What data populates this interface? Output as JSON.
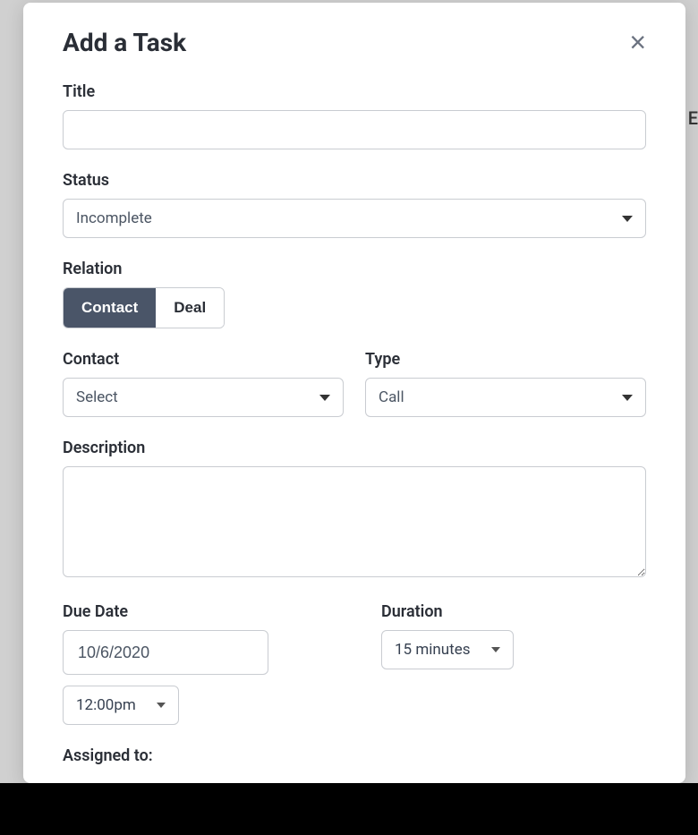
{
  "background": {
    "letter": "E"
  },
  "modal": {
    "title": "Add a Task",
    "fields": {
      "title_label": "Title",
      "status_label": "Status",
      "status_value": "Incomplete",
      "relation_label": "Relation",
      "relation_options": {
        "contact": "Contact",
        "deal": "Deal"
      },
      "relation_active": "contact",
      "contact_label": "Contact",
      "contact_value": "Select",
      "type_label": "Type",
      "type_value": "Call",
      "description_label": "Description",
      "duedate_label": "Due Date",
      "duedate_value": "10/6/2020",
      "duedate_time": "12:00pm",
      "duration_label": "Duration",
      "duration_value": "15 minutes",
      "assigned_label": "Assigned to:"
    }
  }
}
